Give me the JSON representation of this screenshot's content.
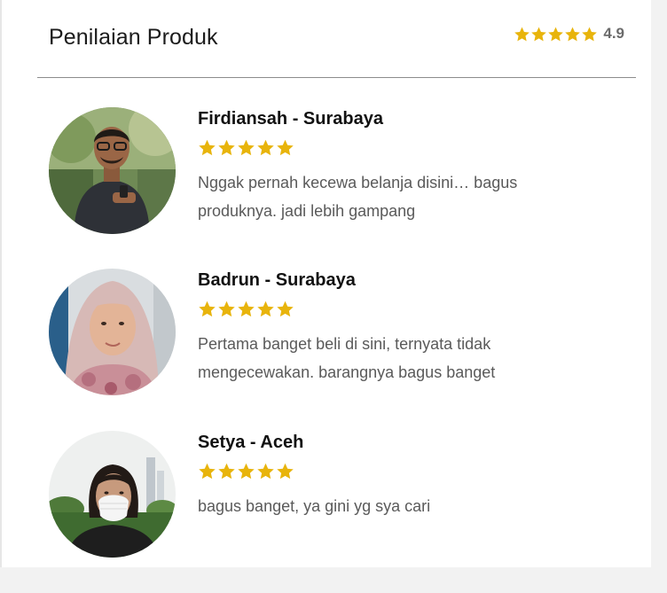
{
  "header": {
    "title": "Penilaian Produk",
    "rating": "4.9",
    "star_count": 5
  },
  "colors": {
    "star": "#e8b40c",
    "divider": "#8c8c8c"
  },
  "reviews": [
    {
      "name": "Firdiansah - Surabaya",
      "stars": 5,
      "text": "Nggak pernah kecewa belanja disini… bagus produknya. jadi lebih gampang",
      "avatar": "man-with-glasses-photo"
    },
    {
      "name": "Badrun - Surabaya",
      "stars": 5,
      "text": "Pertama banget beli di sini, ternyata tidak mengecewakan. barangnya bagus banget",
      "avatar": "woman-in-hijab-photo"
    },
    {
      "name": "Setya - Aceh",
      "stars": 5,
      "text": "bagus banget, ya gini yg sya cari",
      "avatar": "woman-with-mask-photo"
    }
  ]
}
